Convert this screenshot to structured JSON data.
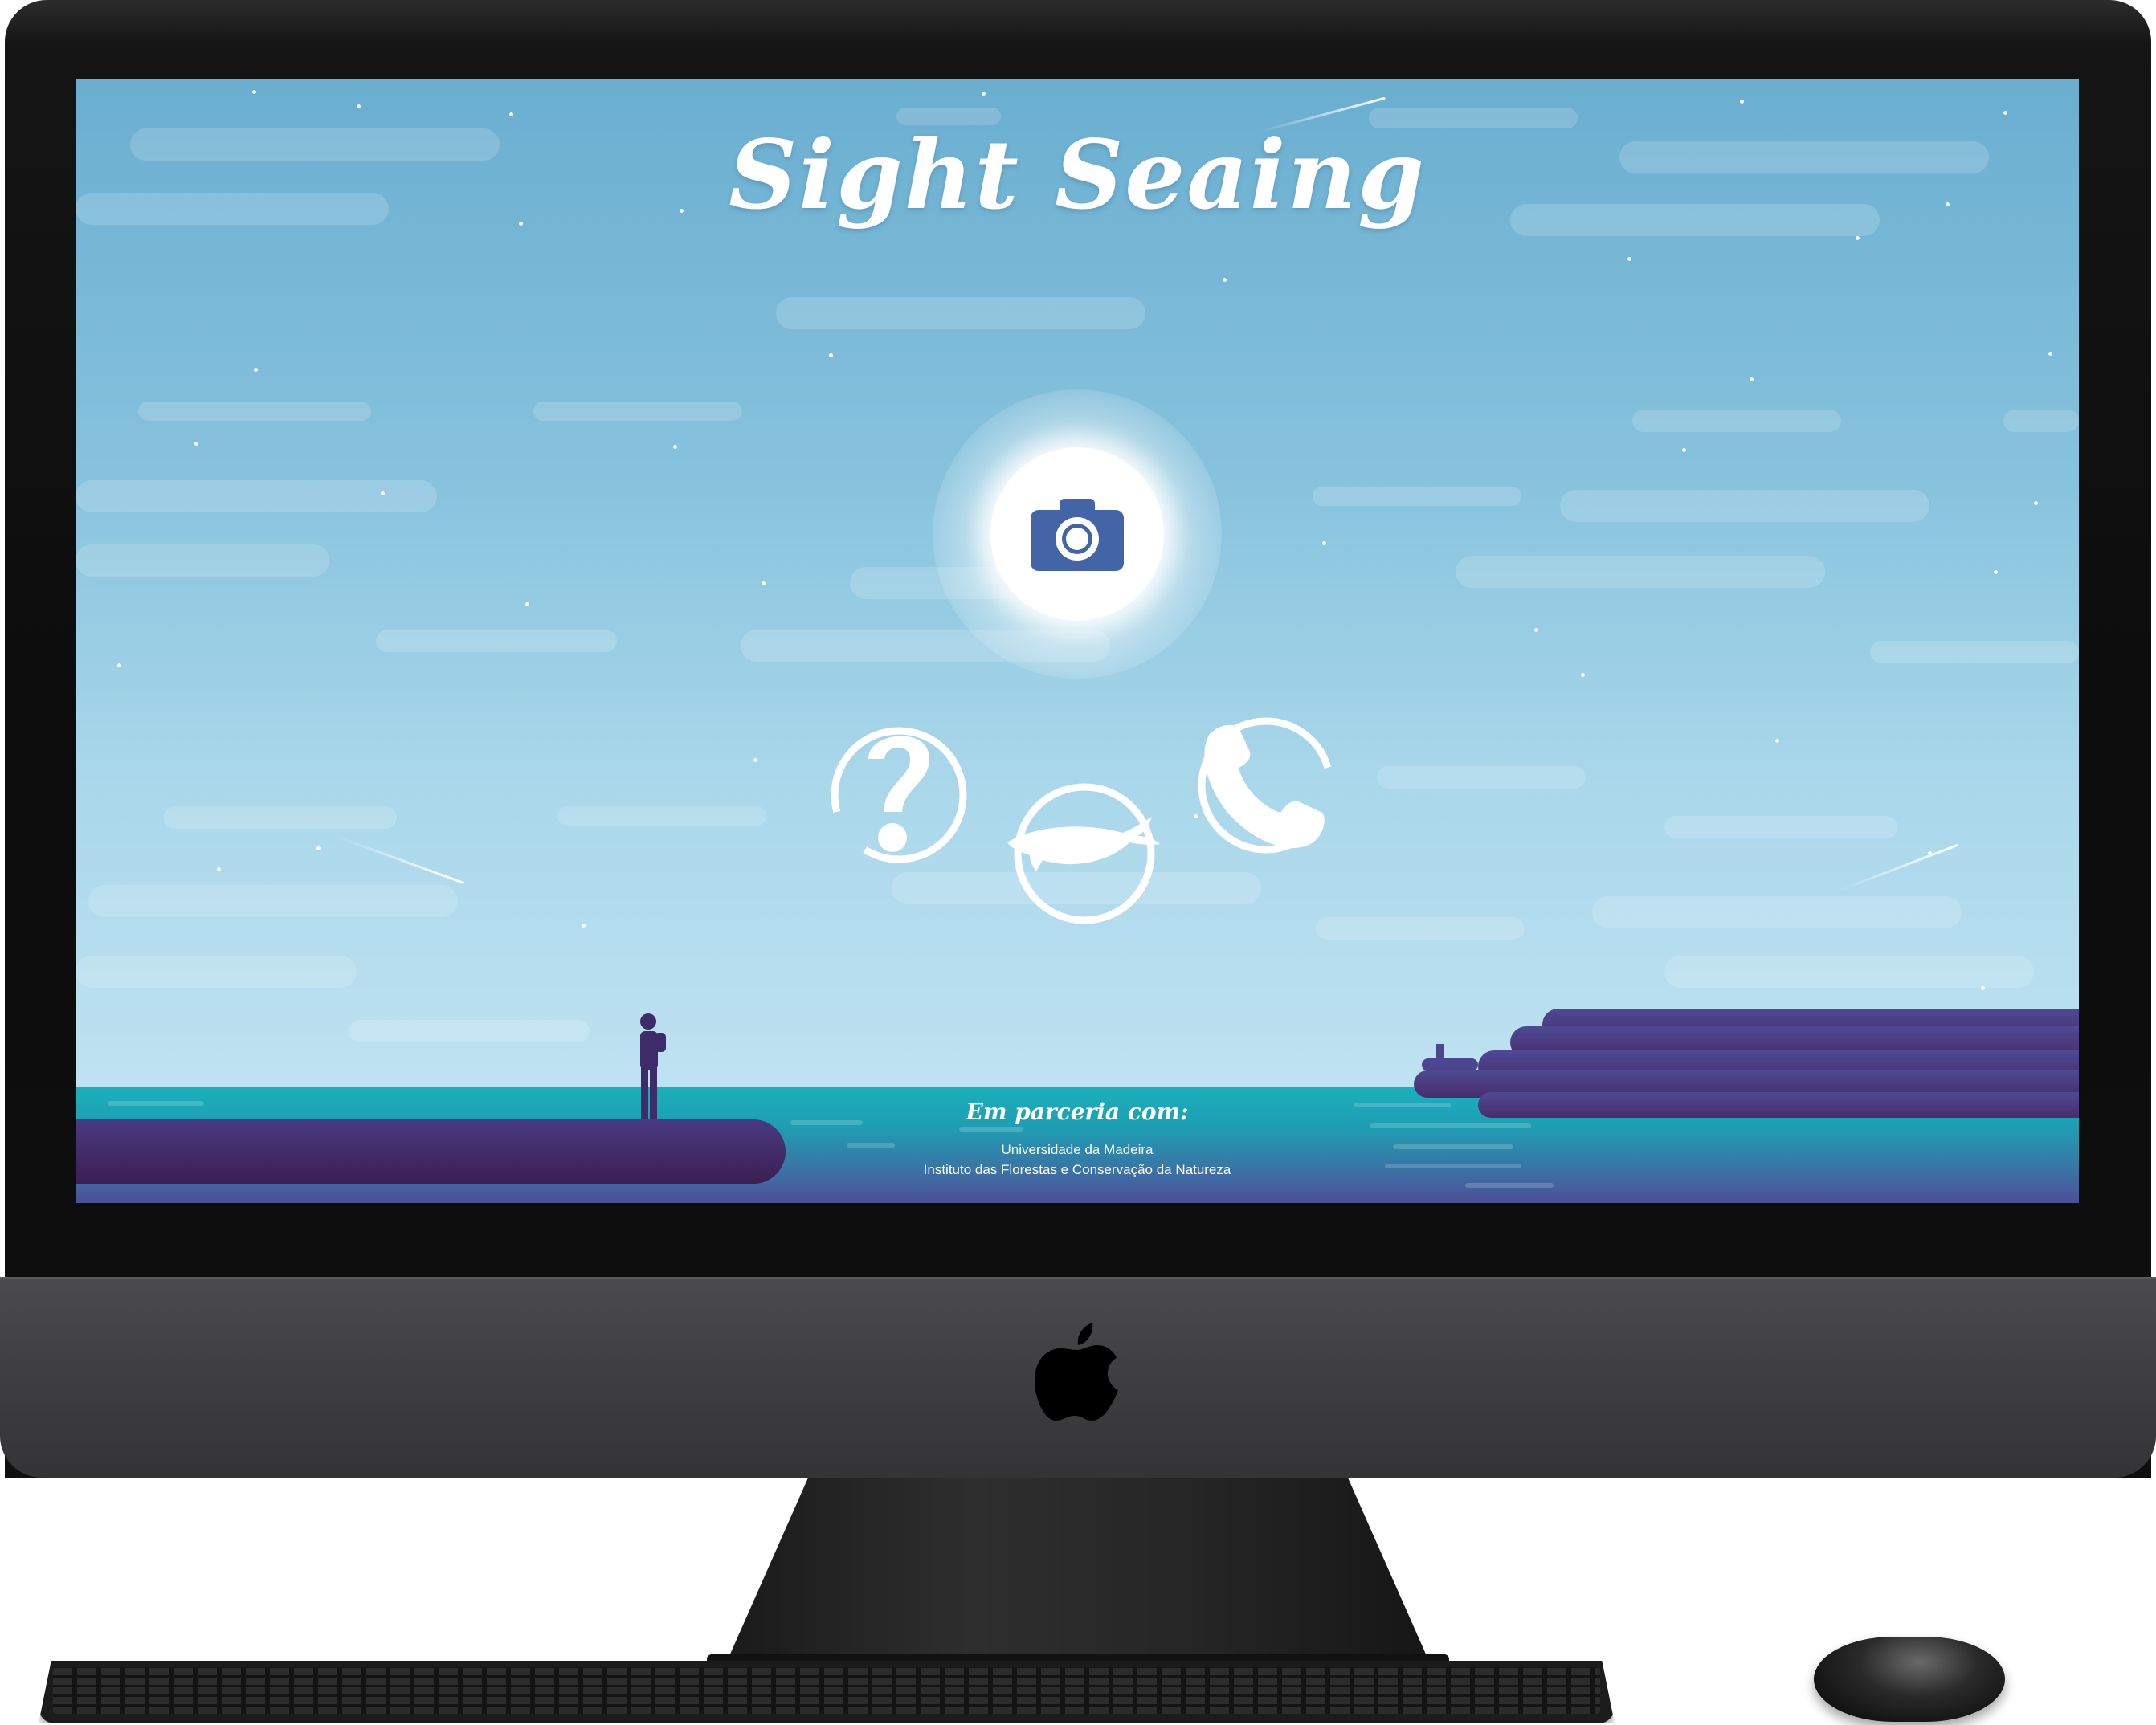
{
  "app": {
    "title": "Sight Seaing"
  },
  "actions": {
    "camera_icon": "camera-icon",
    "help_icon": "question-mark-icon",
    "whale_icon": "whale-icon",
    "phone_icon": "phone-icon"
  },
  "footer": {
    "partners_heading": "Em parceria com:",
    "partners": [
      "Universidade da Madeira",
      "Instituto das Florestas e Conservação da Natureza"
    ]
  },
  "colors": {
    "sky_top": "#6aaed0",
    "sky_bottom": "#c6e6f4",
    "sea": "#1ab0bb",
    "land": "#4a3a84",
    "accent_icon": "#3f6aa8"
  }
}
